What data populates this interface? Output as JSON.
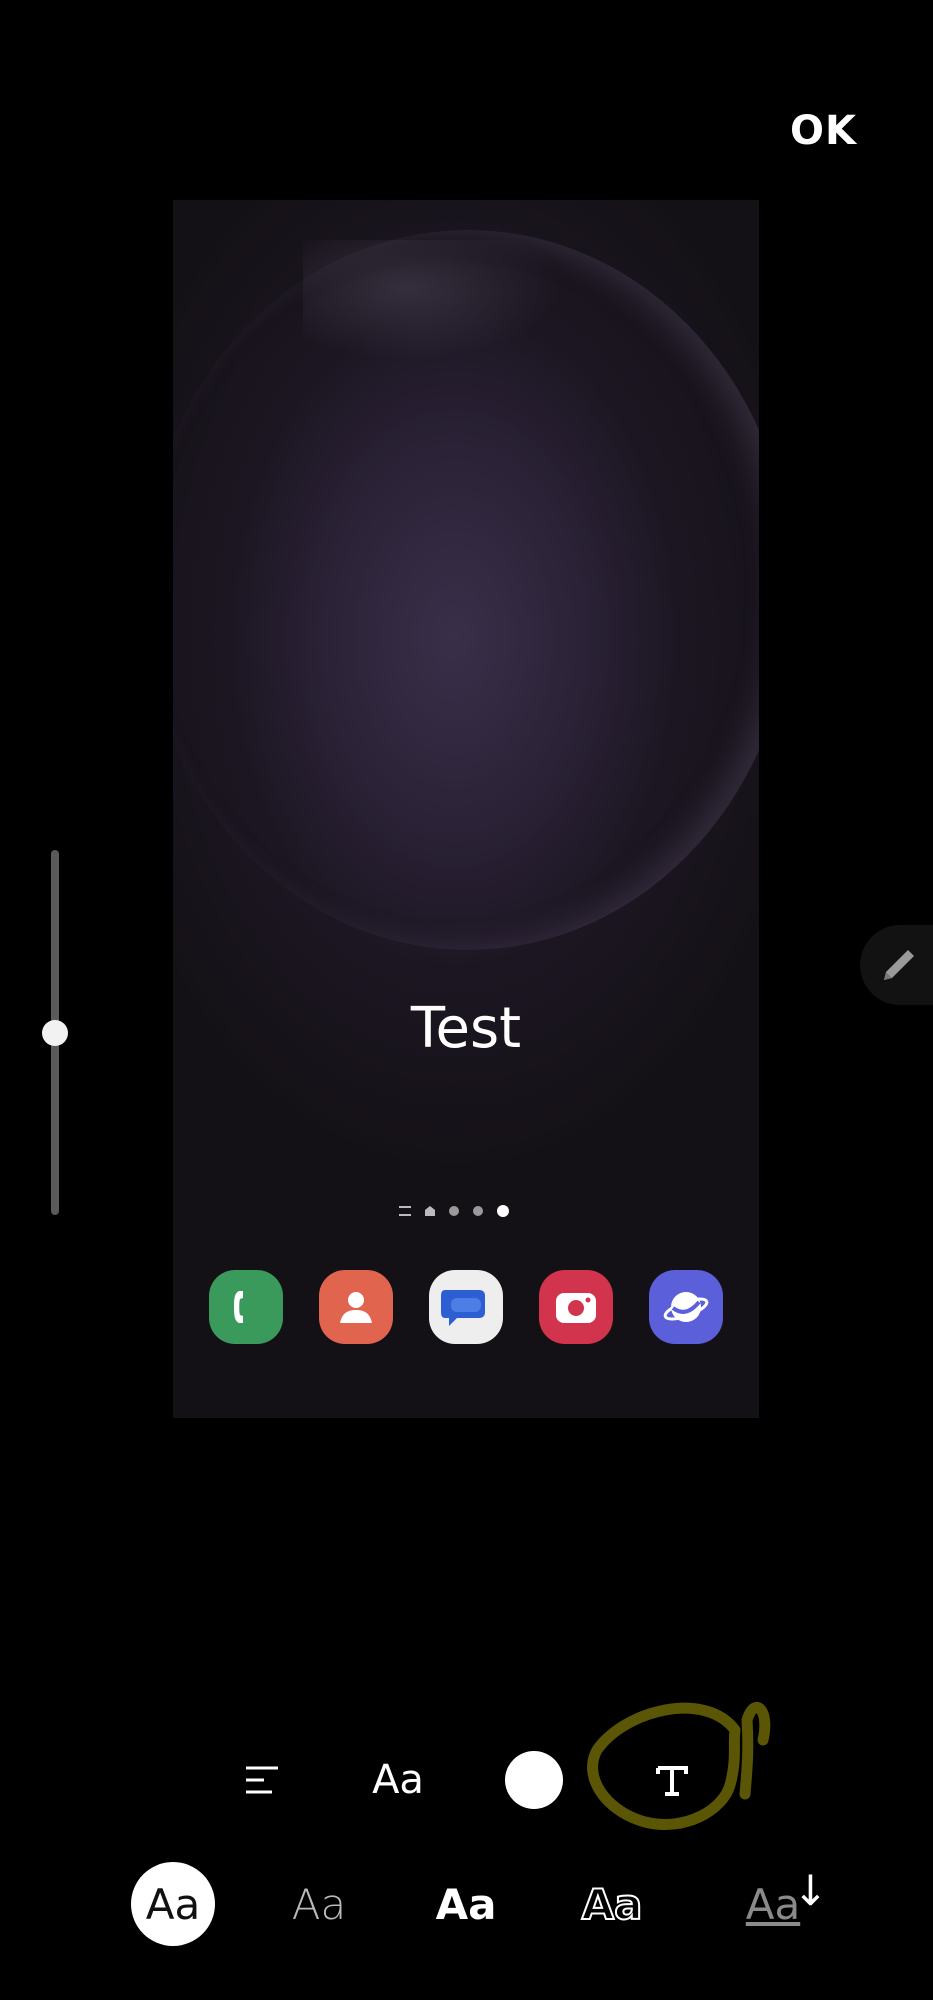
{
  "header": {
    "ok_label": "OK"
  },
  "preview": {
    "text": "Test",
    "page_indicator": {
      "pages": 4,
      "active_index": 3
    },
    "dock_apps": [
      {
        "name": "Phone",
        "icon": "phone-icon",
        "color": "#3a9a5b"
      },
      {
        "name": "Contacts",
        "icon": "contacts-icon",
        "color": "#e1644f"
      },
      {
        "name": "Messages",
        "icon": "messages-icon",
        "color": "#eeeeee"
      },
      {
        "name": "Camera",
        "icon": "camera-icon",
        "color": "#d2334d"
      },
      {
        "name": "Internet",
        "icon": "internet-icon",
        "color": "#5b5fd9"
      }
    ]
  },
  "size_slider": {
    "value": 0.5
  },
  "toolbar": {
    "font_label": "Aa",
    "color_value": "#ffffff",
    "highlight_color": "#5a5606"
  },
  "font_styles": [
    {
      "label": "Aa",
      "selected": true
    },
    {
      "label": "Aa",
      "selected": false
    },
    {
      "label": "Aa",
      "selected": false
    },
    {
      "label": "Aa",
      "selected": false
    },
    {
      "label": "Aa",
      "selected": false
    }
  ]
}
